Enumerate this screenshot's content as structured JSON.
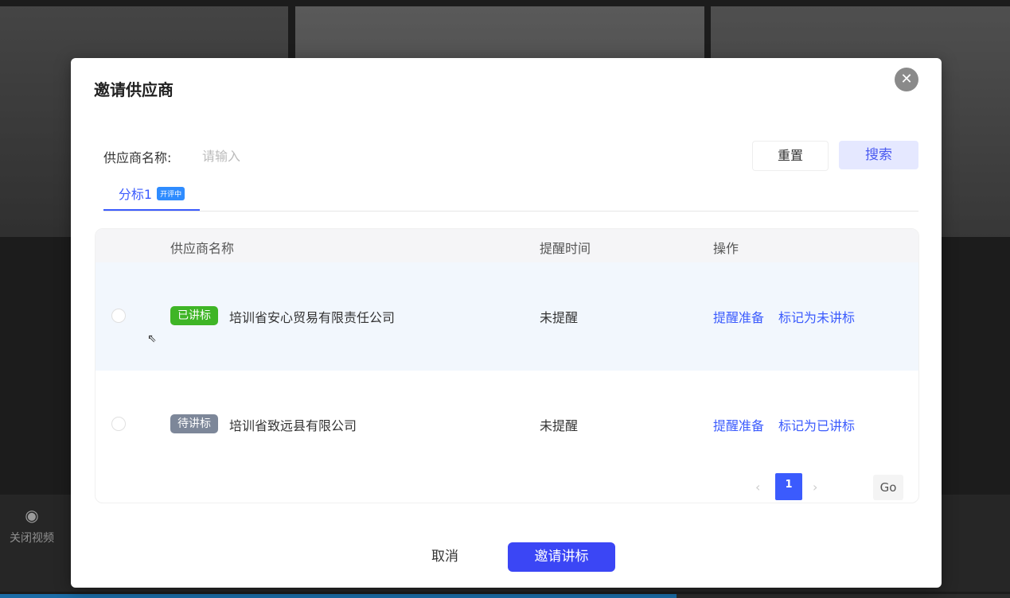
{
  "background": {
    "video_toggle_label": "关闭视频",
    "progress_fraction": 0.67
  },
  "modal": {
    "title": "邀请供应商",
    "close_icon": "close-icon"
  },
  "filter": {
    "label": "供应商名称:",
    "input_value": "",
    "input_placeholder": "请输入",
    "reset_label": "重置",
    "search_label": "搜索"
  },
  "tabs": [
    {
      "label": "分标1",
      "badge": "开评中",
      "active": true
    }
  ],
  "table": {
    "headers": {
      "supplier": "供应商名称",
      "remind_time": "提醒时间",
      "actions": "操作"
    },
    "rows": [
      {
        "status": "已讲标",
        "status_color": "#3fb526",
        "supplier": "培训省安心贸易有限责任公司",
        "remind_time": "未提醒",
        "action1": "提醒准备",
        "action2": "标记为未讲标",
        "highlighted": true
      },
      {
        "status": "待讲标",
        "status_color": "#7d8799",
        "supplier": "培训省致远县有限公司",
        "remind_time": "未提醒",
        "action1": "提醒准备",
        "action2": "标记为已讲标",
        "highlighted": false
      }
    ]
  },
  "pagination": {
    "prev": "‹",
    "current": "1",
    "next": "›",
    "go_label": "Go"
  },
  "footer": {
    "cancel_label": "取消",
    "invite_label": "邀请讲标"
  },
  "colors": {
    "accent": "#3b5bfd",
    "primary_button": "#3b46f5",
    "status_done": "#3fb526",
    "status_pending": "#7d8799"
  }
}
